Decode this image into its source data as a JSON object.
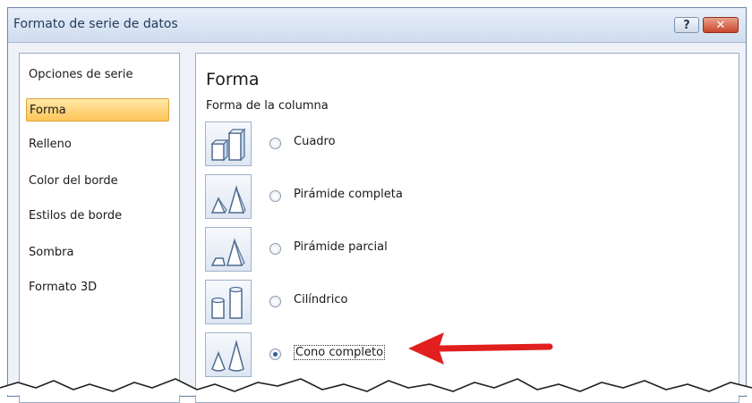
{
  "window": {
    "title": "Formato de serie de datos",
    "help_glyph": "?",
    "close_glyph": "✕"
  },
  "sidebar": {
    "items": [
      {
        "label": "Opciones de serie",
        "active": false
      },
      {
        "label": "Forma",
        "active": true
      },
      {
        "label": "Relleno",
        "active": false
      },
      {
        "label": "Color del borde",
        "active": false
      },
      {
        "label": "Estilos de borde",
        "active": false
      },
      {
        "label": "Sombra",
        "active": false
      },
      {
        "label": "Formato 3D",
        "active": false
      }
    ]
  },
  "main": {
    "section_title": "Forma",
    "subsection_title": "Forma de la columna",
    "options": [
      {
        "label": "Cuadro",
        "checked": false,
        "icon": "box-column-icon"
      },
      {
        "label": "Pirámide completa",
        "checked": false,
        "icon": "full-pyramid-icon"
      },
      {
        "label": "Pirámide parcial",
        "checked": false,
        "icon": "partial-pyramid-icon"
      },
      {
        "label": "Cilíndrico",
        "checked": false,
        "icon": "cylinder-icon"
      },
      {
        "label": "Cono completo",
        "checked": true,
        "icon": "full-cone-icon"
      }
    ]
  },
  "colors": {
    "accent_arrow": "#e11f1f",
    "active_item": "#ffc457",
    "title_text": "#1e395b"
  }
}
